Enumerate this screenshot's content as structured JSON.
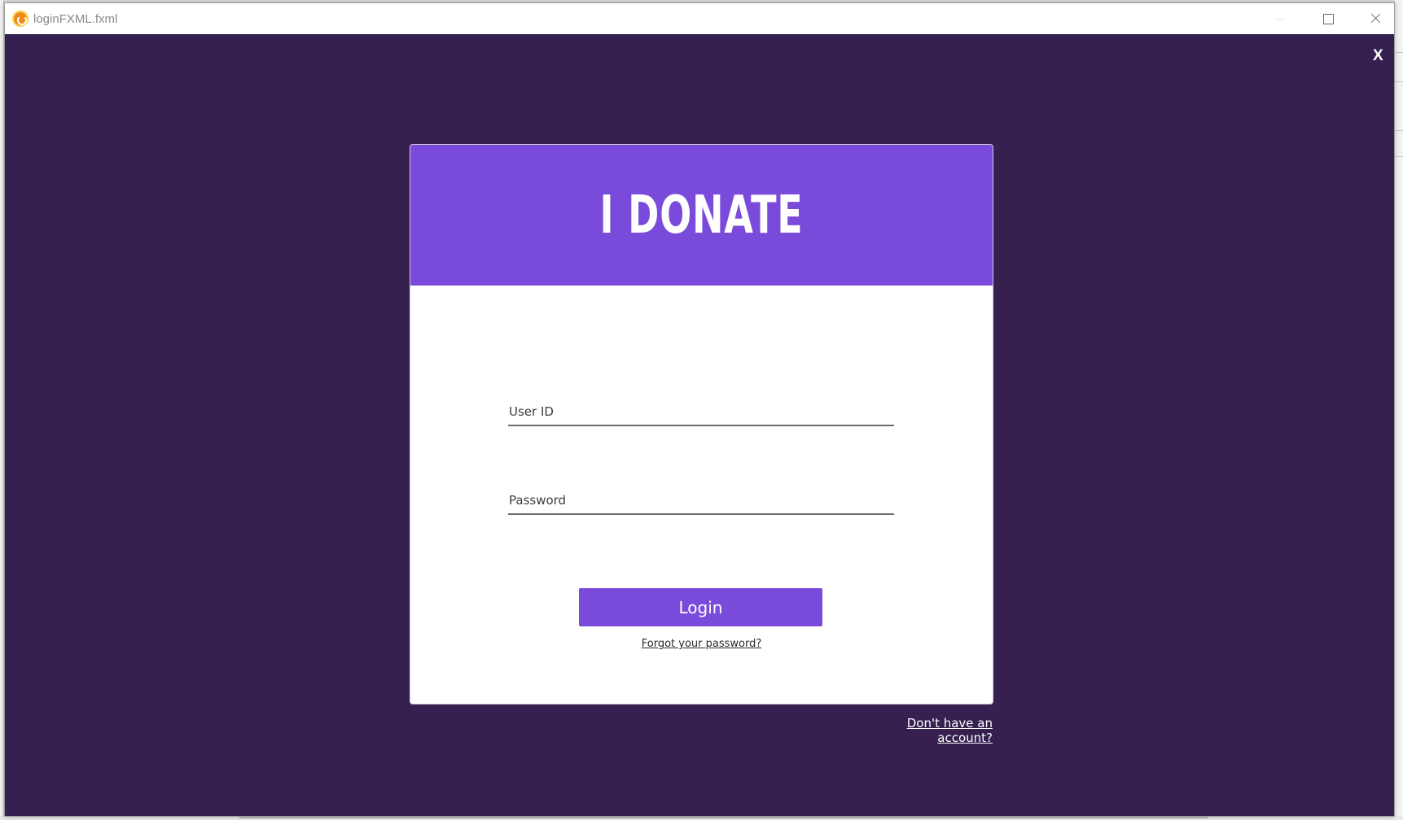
{
  "window": {
    "title": "loginFXML.fxml"
  },
  "app": {
    "close_label": "X",
    "brand": "I DONATE"
  },
  "form": {
    "user_id_placeholder": "User ID",
    "password_placeholder": "Password",
    "login_label": "Login",
    "forgot_label": "Forgot  your password?",
    "signup_label": "Don't have an account?"
  },
  "colors": {
    "background": "#35204f",
    "accent": "#7a4adb",
    "card": "#ffffff"
  }
}
